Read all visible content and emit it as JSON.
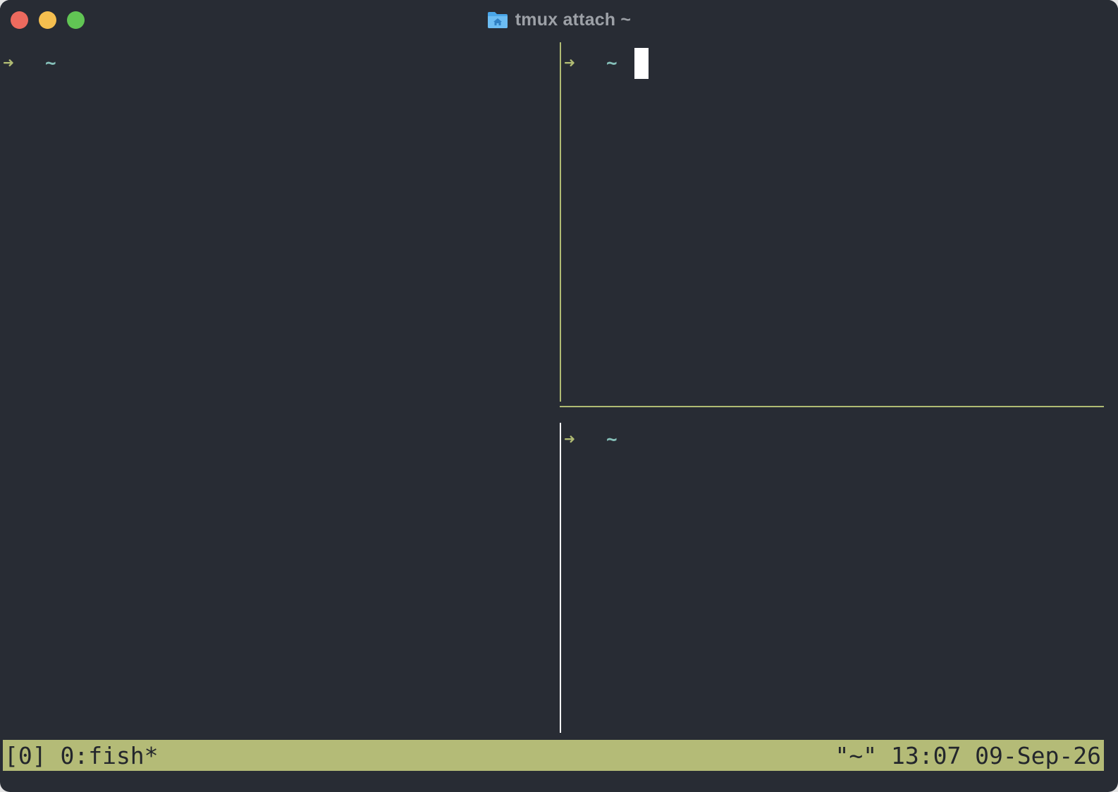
{
  "window": {
    "title": "tmux attach ~",
    "icon": "home-folder-icon"
  },
  "panes": {
    "left": {
      "prompt_arrow": "➜",
      "prompt_cwd": "~"
    },
    "top_right": {
      "prompt_arrow": "➜",
      "prompt_cwd": "~",
      "active": true
    },
    "bottom_right": {
      "prompt_arrow": "➜",
      "prompt_cwd": "~"
    }
  },
  "statusbar": {
    "session_window": "[0] 0:fish*",
    "right_info": "\"~\" 13:07 09-Sep-26"
  },
  "colors": {
    "background": "#282c34",
    "accent": "#b4bb77",
    "prompt_arrow": "#b0bb73",
    "prompt_cwd": "#85bfb8"
  }
}
